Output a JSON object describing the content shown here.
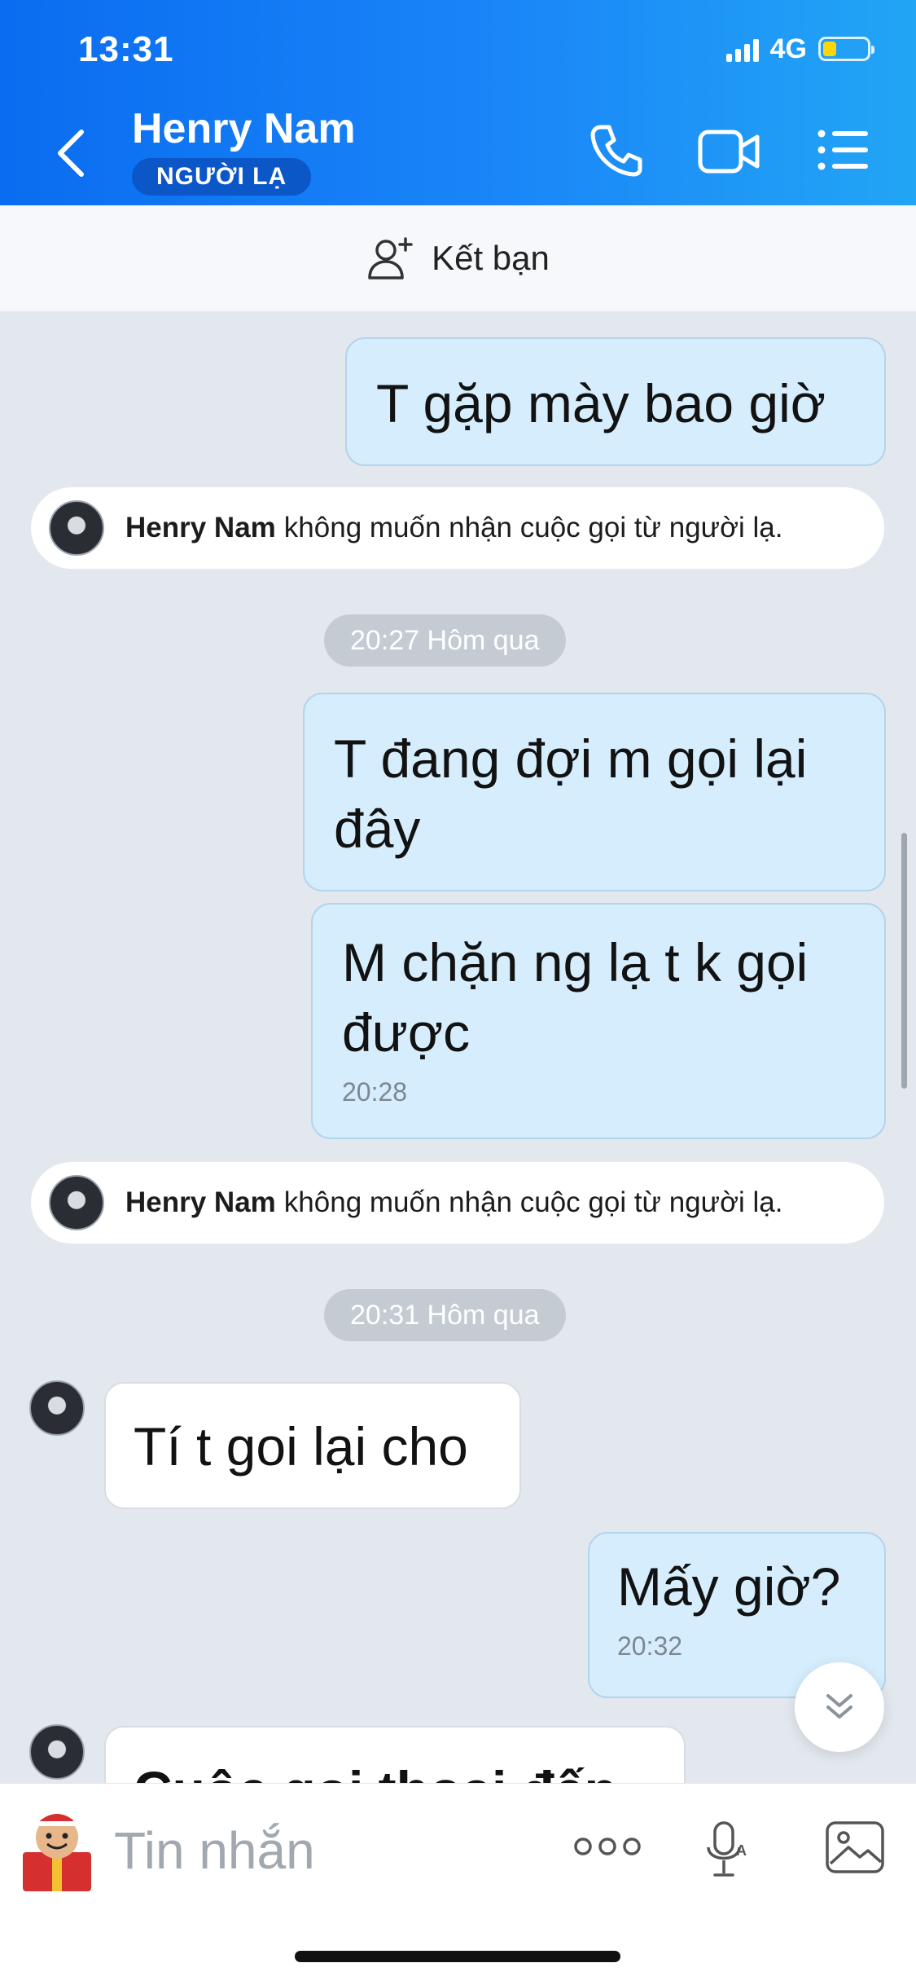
{
  "status_bar": {
    "time": "13:31",
    "network": "4G"
  },
  "header": {
    "name": "Henry Nam",
    "badge": "NGƯỜI LẠ",
    "colors": {
      "start": "#0a6cf0",
      "end": "#22a5f5"
    }
  },
  "add_friend": {
    "label": "Kết bạn"
  },
  "messages": {
    "out_1": "T gặp mày bao giờ",
    "sys_1": {
      "name": "Henry Nam",
      "text": "không muốn nhận cuộc gọi từ người lạ."
    },
    "time_1": "20:27 Hôm qua",
    "out_2": "T đang đợi m gọi lại đây",
    "out_3": "M chặn ng lạ t k gọi được",
    "out_3_time": "20:28",
    "sys_2": {
      "name": "Henry Nam",
      "text": "không muốn nhận cuộc gọi từ người lạ."
    },
    "time_2": "20:31 Hôm qua",
    "in_1": "Tí t goi lại cho",
    "out_4": "Mấy giờ?",
    "out_4_time": "20:32",
    "in_2_partial": "Cuộc gọi thoại đến"
  },
  "composer": {
    "placeholder": "Tin nhắn"
  },
  "icons": {
    "back": "chevron-left-icon",
    "call": "phone-icon",
    "video": "video-camera-icon",
    "menu": "list-menu-icon",
    "add_friend": "add-person-icon",
    "more": "more-dots-icon",
    "voice": "mic-icon",
    "image": "image-icon",
    "scroll_down": "double-chevron-down-icon"
  }
}
